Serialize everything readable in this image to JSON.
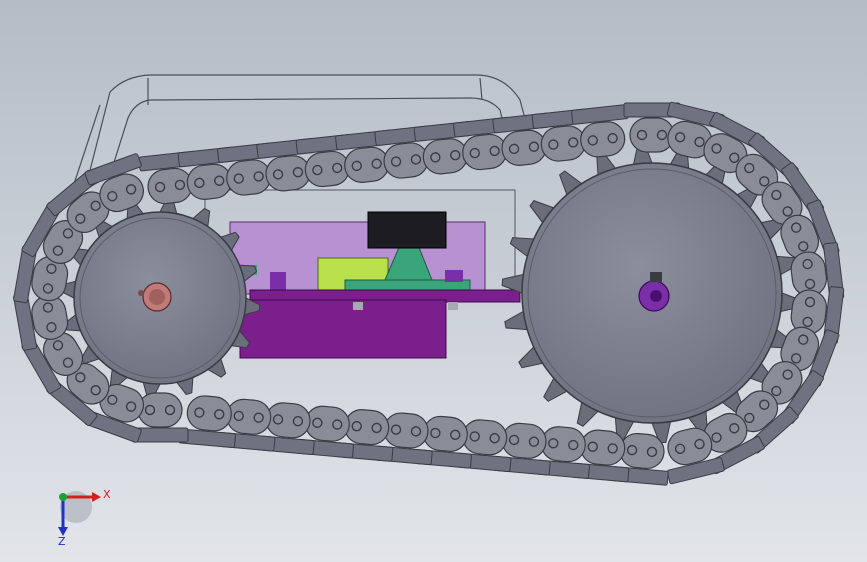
{
  "colors": {
    "bg_top": "#b4bcc6",
    "bg_bottom": "#dfe3e8",
    "link_fill": "#8a8d98",
    "link_stroke": "#3a3c44",
    "pad_fill": "#6f7280",
    "wheel_fill": "#7c7f8e",
    "sprocket_fill": "#6a6d7a",
    "purple": "#7a1f8c",
    "purple_light": "#9b5db0",
    "green": "#3aa57a",
    "yellow_green": "#b8e04a",
    "black_block": "#1c1c22",
    "hub_left": "#c07a78",
    "hub_right": "#7a2fa8",
    "axis_x": "#d62020",
    "axis_y": "#1fa030",
    "axis_z": "#2030c8"
  },
  "axes": {
    "x_label": "X",
    "z_label": "Z",
    "icon": "coordinate-triad-icon"
  }
}
